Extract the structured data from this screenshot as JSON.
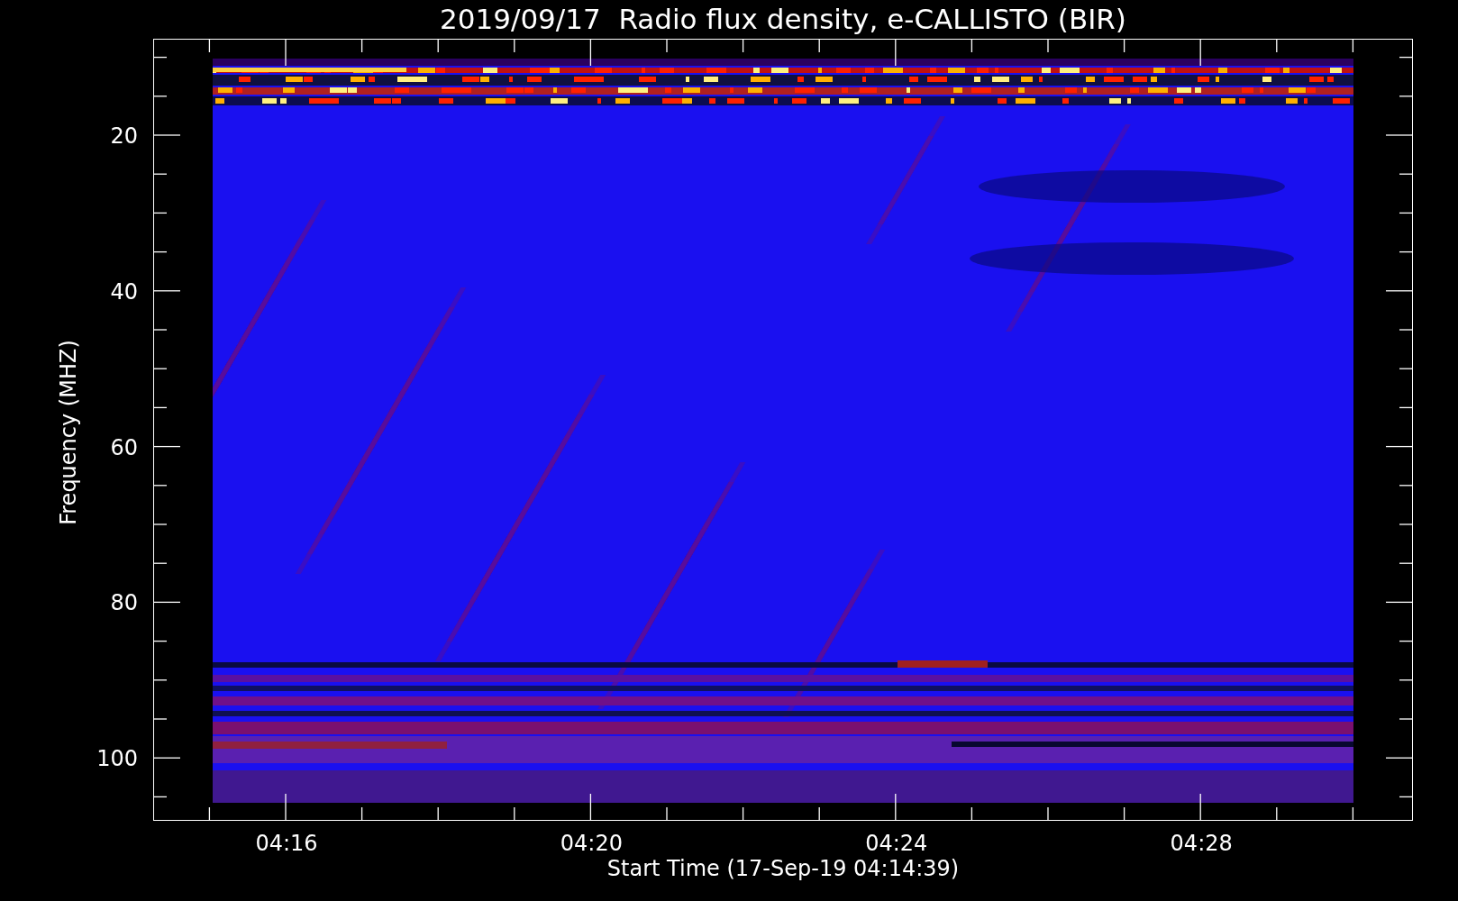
{
  "title": "2019/09/17  Radio flux density, e-CALLISTO (BIR)",
  "chart": {
    "y_axis": {
      "label": "Frequency (MHZ)",
      "ticks": [
        "20",
        "40",
        "60",
        "80",
        "100"
      ]
    },
    "x_axis": {
      "label": "Start Time (17-Sep-19 04:14:39)",
      "ticks": [
        "04:16",
        "04:20",
        "04:24",
        "04:28"
      ]
    }
  }
}
